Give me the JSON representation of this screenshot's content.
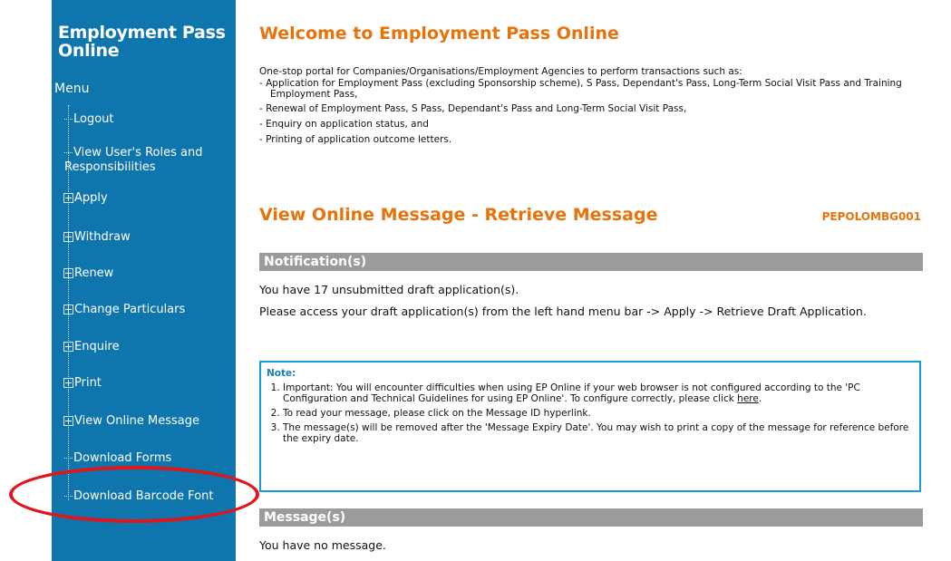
{
  "app_title": "Employment Pass Online",
  "sidebar": {
    "menu_label": "Menu",
    "items": [
      {
        "label": "Logout",
        "expandable": false
      },
      {
        "label": "View User's Roles and Responsibilities",
        "expandable": false
      },
      {
        "label": "Apply",
        "expandable": true
      },
      {
        "label": "Withdraw",
        "expandable": true
      },
      {
        "label": "Renew",
        "expandable": true
      },
      {
        "label": "Change Particulars",
        "expandable": true
      },
      {
        "label": "Enquire",
        "expandable": true
      },
      {
        "label": "Print",
        "expandable": true
      },
      {
        "label": "View Online Message",
        "expandable": true
      },
      {
        "label": "Download Forms",
        "expandable": false
      },
      {
        "label": "Download Barcode Font",
        "expandable": false
      }
    ]
  },
  "main": {
    "welcome_title": "Welcome to Employment Pass Online",
    "intro": "One-stop portal for Companies/Organisations/Employment Agencies to perform transactions such as:",
    "bullets": [
      "- Application for Employment Pass (excluding Sponsorship scheme), S Pass, Dependant's Pass, Long-Term Social Visit Pass and Training Employment Pass,",
      "- Renewal of Employment Pass, S Pass, Dependant's Pass and Long-Term Social Visit Pass,",
      "- Enquiry on application status, and",
      "- Printing of application outcome letters."
    ],
    "section_title": "View Online Message - Retrieve Message",
    "page_code": "PEPOLOMBG001",
    "notifications_header": "Notification(s)",
    "notification_1": "You have 17 unsubmitted draft application(s).",
    "notification_2": "Please access your draft application(s) from the left hand menu bar -> Apply -> Retrieve Draft Application.",
    "note_label": "Note:",
    "note_1_pre": "Important: You will encounter difficulties when using EP Online if your web browser is not configured according to the 'PC Configuration and Technical Guidelines for using EP Online'. To configure correctly, please click ",
    "note_1_link": "here",
    "note_1_post": ".",
    "note_2": "To read your message, please click on the Message ID hyperlink.",
    "note_3": "The message(s) will be removed after the 'Message Expiry Date'. You may wish to print a copy of the message for reference before the expiry date.",
    "messages_header": "Message(s)",
    "messages_empty": "You have no message."
  },
  "colors": {
    "sidebar_bg": "#0f75ad",
    "heading_orange": "#e8730b",
    "bar_gray": "#9b9b9b",
    "note_border": "#1a9ad8",
    "annotation_red": "#e0161a"
  }
}
